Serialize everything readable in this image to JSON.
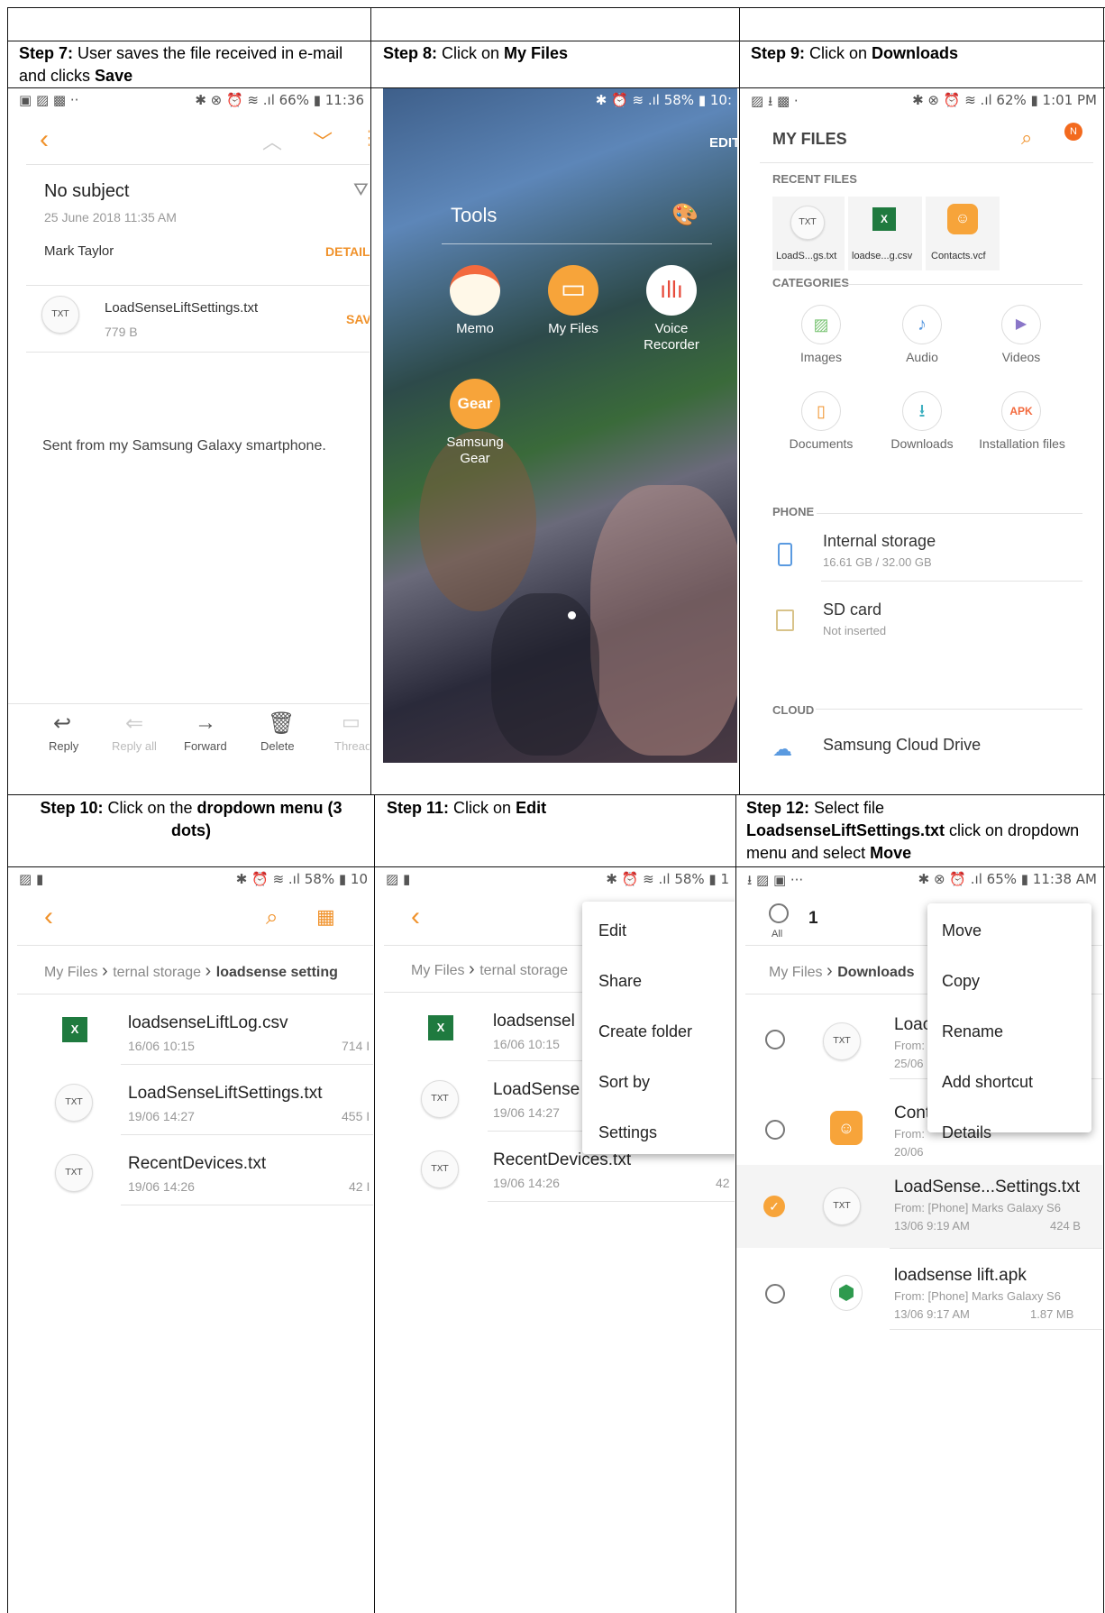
{
  "cells": {
    "step7": {
      "prefix": "Step 7:",
      "text": " User saves the file received in e-mail and clicks ",
      "bold_end": "Save"
    },
    "step8": {
      "prefix": "Step 8:",
      "text": " Click on ",
      "bold_end": "My Files"
    },
    "step9": {
      "prefix": "Step 9:",
      "text": " Click on ",
      "bold_end": "Downloads"
    },
    "step10": {
      "prefix": "Step 10:",
      "text": " Click on the ",
      "bold_end": "dropdown menu (3 dots)"
    },
    "step11": {
      "prefix": "Step 11:",
      "text": " Click on ",
      "bold_end": "Edit"
    },
    "step12": {
      "prefix": "Step 12:",
      "text": " Select file",
      "bold_mid": "LoadsenseLiftSettings.txt",
      "text2": " click on dropdown menu and select ",
      "bold_end": "Move"
    }
  },
  "email": {
    "status_left": "▣ ▨ ▩ ··",
    "status_right": "✱ ⊗ ⏰ ≋ .ıl 66% ▮ 11:36",
    "subject": "No subject",
    "date": "25 June 2018  11:35 AM",
    "sender": "Mark Taylor",
    "details": "DETAILS",
    "attachment_badge": "TXT",
    "attachment_name": "LoadSenseLiftSettings.txt",
    "attachment_size": "779 B",
    "save": "SAVE",
    "body": "Sent from my Samsung Galaxy smartphone.",
    "actions": [
      "Reply",
      "Reply all",
      "Forward",
      "Delete",
      "Thread"
    ]
  },
  "home": {
    "status_right": "✱ ⏰ ≋ .ıl 58% ▮ 10:",
    "edit": "EDIT",
    "folder": "Tools",
    "apps": [
      "Memo",
      "My Files",
      "Voice Recorder",
      "Samsung Gear"
    ],
    "gear_logo": "Gear"
  },
  "myfiles": {
    "status_left": "▨ ⭳ ▩ ·",
    "status_right": "✱ ⊗ ⏰ ≋ .ıl 62% ▮ 1:01 PM",
    "title": "MY FILES",
    "recent_header": "RECENT FILES",
    "recent": [
      "LoadS...gs.txt",
      "loadse...g.csv",
      "Contacts.vcf"
    ],
    "recent_badge": "TXT",
    "categories_header": "CATEGORIES",
    "categories": [
      "Images",
      "Audio",
      "Videos",
      "Documents",
      "Downloads",
      "Installation files"
    ],
    "apk_label": "APK",
    "phone_header": "PHONE",
    "internal": "Internal storage",
    "internal_size": "16.61 GB / 32.00 GB",
    "sd": "SD card",
    "sd_status": "Not inserted",
    "cloud_header": "CLOUD",
    "cloud": "Samsung Cloud Drive"
  },
  "folder10": {
    "status_left": "▨ ▮",
    "status_right": "✱ ⏰ ≋ .ıl 58% ▮ 10",
    "breadcrumb": [
      "My Files",
      "ternal storage",
      "loadsense setting"
    ],
    "files": [
      {
        "name": "loadsenseLiftLog.csv",
        "date": "16/06 10:15",
        "size": "714 I"
      },
      {
        "name": "LoadSenseLiftSettings.txt",
        "date": "19/06 14:27",
        "size": "455 I"
      },
      {
        "name": "RecentDevices.txt",
        "date": "19/06 14:26",
        "size": "42 I"
      }
    ],
    "badge": "TXT"
  },
  "folder11": {
    "status_left": "▨ ▮",
    "status_right": "✱ ⏰ ≋ .ıl 58% ▮ 1",
    "breadcrumb": [
      "My Files",
      "ternal storage"
    ],
    "files": [
      {
        "name": "loadsensel",
        "date": "16/06 10:15"
      },
      {
        "name": "LoadSense",
        "date": "19/06 14:27"
      },
      {
        "name": "RecentDevices.txt",
        "date": "19/06 14:26",
        "size": "42"
      }
    ],
    "badge": "TXT",
    "menu": [
      "Edit",
      "Share",
      "Create folder",
      "Sort by",
      "Settings"
    ]
  },
  "downloads": {
    "status_left": "⭳ ▨ ▣ ···",
    "status_right": "✱ ⊗ ⏰ .ıl 65% ▮ 11:38 AM",
    "selected_count": "1",
    "all": "All",
    "breadcrumb": [
      "My Files",
      "Downloads"
    ],
    "files": [
      {
        "name": "Loac",
        "from": "From:",
        "date": "25/06"
      },
      {
        "name": "Cont",
        "from": "From:",
        "date": "20/06"
      },
      {
        "name": "LoadSense...Settings.txt",
        "from": "From: [Phone] Marks Galaxy S6",
        "date": "13/06 9:19 AM",
        "size": "424 B"
      },
      {
        "name": "loadsense lift.apk",
        "from": "From: [Phone] Marks Galaxy S6",
        "date": "13/06 9:17 AM",
        "size": "1.87 MB"
      }
    ],
    "badge": "TXT",
    "menu": [
      "Move",
      "Copy",
      "Rename",
      "Add shortcut",
      "Details"
    ]
  }
}
